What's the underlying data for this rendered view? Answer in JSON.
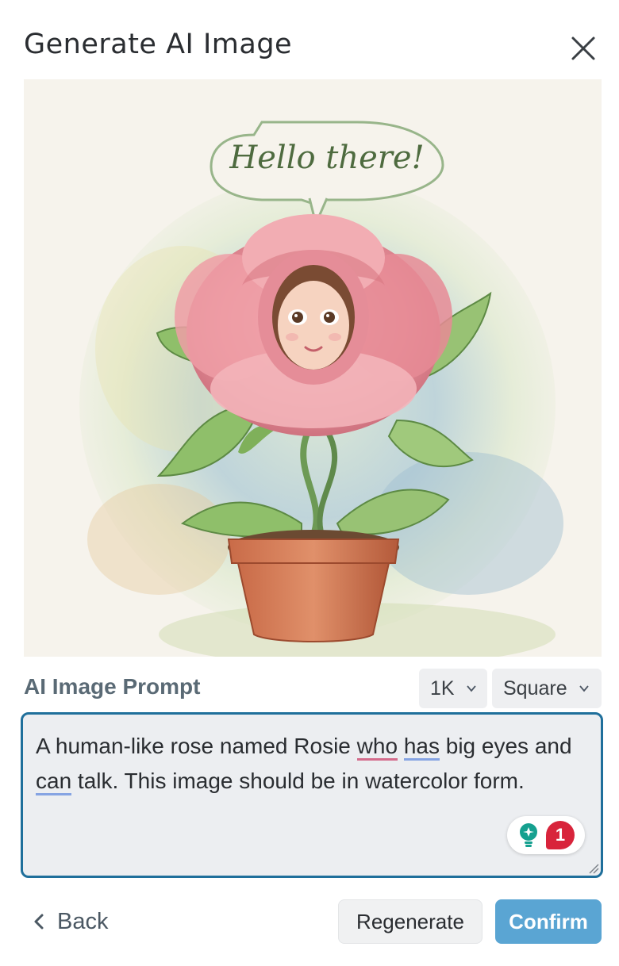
{
  "dialog": {
    "title": "Generate AI Image",
    "close_icon": "close-icon"
  },
  "image": {
    "speech_bubble_text": "Hello there!",
    "description_icon": "generated-image"
  },
  "prompt": {
    "label": "AI Image Prompt",
    "size_select": {
      "value": "1K"
    },
    "shape_select": {
      "value": "Square"
    },
    "text_parts": [
      "A human-like rose named Rosie ",
      "who",
      " ",
      "has",
      " big eyes and ",
      "can",
      " talk. This image should be in watercolor form."
    ],
    "grammar_badge_count": "1"
  },
  "footer": {
    "back_label": "Back",
    "regenerate_label": "Regenerate",
    "confirm_label": "Confirm"
  },
  "colors": {
    "accent": "#1f6f9b",
    "confirm": "#5aa5d3",
    "badge": "#d8243b"
  }
}
